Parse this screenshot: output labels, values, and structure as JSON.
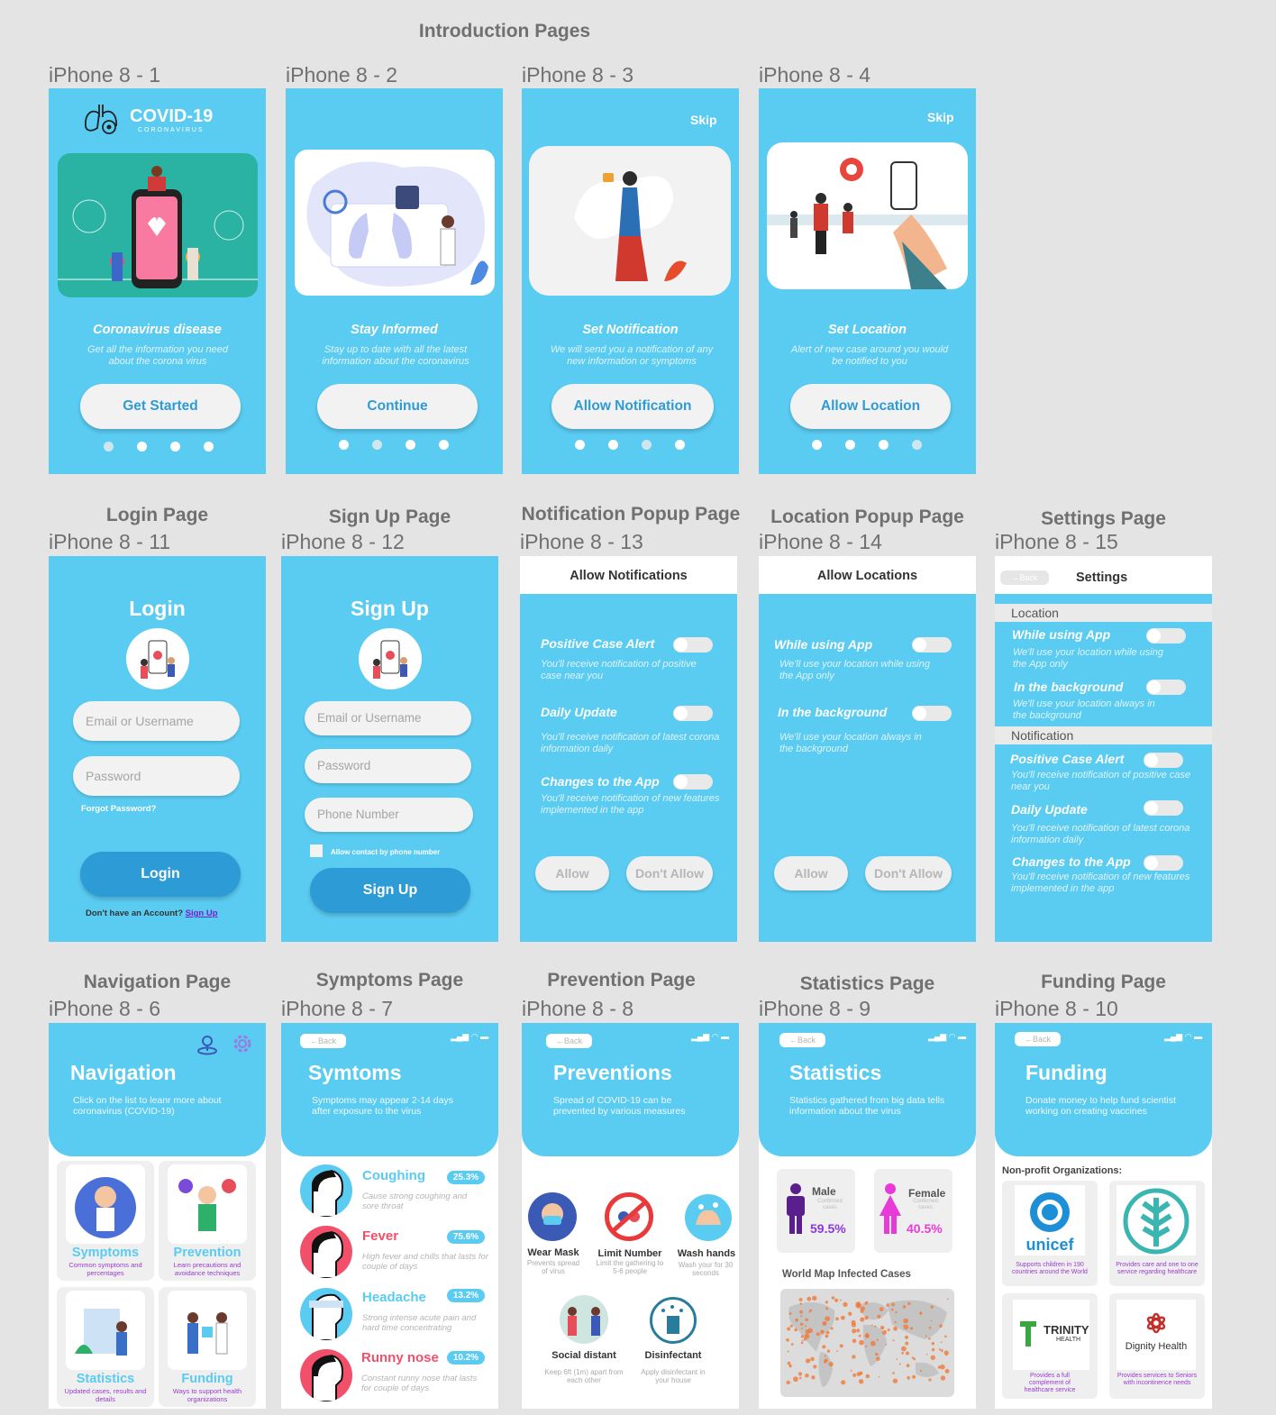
{
  "intro_title": "Introduction Pages",
  "sections": {
    "login": "Login Page",
    "signup": "Sign Up Page",
    "notif_popup": "Notification Popup Page",
    "loc_popup": "Location Popup Page",
    "settings": "Settings Page",
    "navigation": "Navigation Page",
    "symptoms": "Symptoms Page",
    "prevention": "Prevention Page",
    "statistics": "Statistics Page",
    "funding": "Funding Page"
  },
  "frames": {
    "f1": "iPhone 8 - 1",
    "f2": "iPhone 8 - 2",
    "f3": "iPhone 8 - 3",
    "f4": "iPhone 8 - 4",
    "f11": "iPhone 8 - 11",
    "f12": "iPhone 8 - 12",
    "f13": "iPhone 8 - 13",
    "f14": "iPhone 8 - 14",
    "f15": "iPhone 8 - 15",
    "f6": "iPhone 8 - 6",
    "f7": "iPhone 8 - 7",
    "f8": "iPhone 8 - 8",
    "f9": "iPhone 8 - 9",
    "f10": "iPhone 8 - 10"
  },
  "intro": [
    {
      "heading": "Coronavirus disease",
      "desc": "Get all the information you need about the corona virus",
      "button": "Get Started"
    },
    {
      "heading": "Stay Informed",
      "desc": "Stay up to date with all the latest information about the coronavirus",
      "button": "Continue"
    },
    {
      "heading": "Set Notification",
      "desc": "We will send you a notification of any new information or symptoms",
      "button": "Allow Notification",
      "skip": "Skip"
    },
    {
      "heading": "Set Location",
      "desc": "Alert of new case around you  would be notified to you",
      "button": "Allow Location",
      "skip": "Skip"
    }
  ],
  "logo": {
    "title": "COVID-19",
    "subtitle": "CORONAVIRUS"
  },
  "login": {
    "title": "Login",
    "email": "Email or Username",
    "password": "Password",
    "forgot": "Forgot Password?",
    "button": "Login",
    "no_account": "Don't have an Account?",
    "signup_link": "Sign Up"
  },
  "signup": {
    "title": "Sign Up",
    "email": "Email or Username",
    "password": "Password",
    "phone": "Phone Number",
    "allow_contact": "Allow contact by phone number",
    "button": "Sign Up"
  },
  "notif_popup": {
    "title": "Allow Notifications",
    "items": [
      {
        "name": "Positive Case Alert",
        "desc": "You'll receive notification of positive case near you"
      },
      {
        "name": "Daily Update",
        "desc": "You'll receive notification of latest corona information daily"
      },
      {
        "name": "Changes to the App",
        "desc": "You'll receive notification of new features implemented in the app"
      }
    ],
    "allow": "Allow",
    "dont": "Don't Allow"
  },
  "loc_popup": {
    "title": "Allow Locations",
    "items": [
      {
        "name": "While using App",
        "desc": "We'll use your location while using the App only"
      },
      {
        "name": "In the background",
        "desc": "We'll use your location always in the background"
      }
    ],
    "allow": "Allow",
    "dont": "Don't Allow"
  },
  "settings": {
    "back": "Back",
    "title": "Settings",
    "location_label": "Location",
    "notification_label": "Notification",
    "loc_items": [
      {
        "name": "While using App",
        "desc": "We'll use your location while using the App only"
      },
      {
        "name": "In the background",
        "desc": "We'll use your location always in the background"
      }
    ],
    "notif_items": [
      {
        "name": "Positive Case Alert",
        "desc": "You'll receive notification of positive case near you"
      },
      {
        "name": "Daily Update",
        "desc": "You'll receive notification of latest corona information daily"
      },
      {
        "name": "Changes to the App",
        "desc": "You'll receive notification of new features implemented in the app"
      }
    ]
  },
  "navigation": {
    "title": "Navigation",
    "desc": "Click on the list to leanr more about coronavirus (COVID-19)",
    "cards": [
      {
        "title": "Symptoms",
        "desc": "Common symptoms and percentages"
      },
      {
        "title": "Prevention",
        "desc": "Learn precautions and avoidance techniques"
      },
      {
        "title": "Statistics",
        "desc": "Updated cases, results and details"
      },
      {
        "title": "Funding",
        "desc": "Ways to support health organizations"
      }
    ]
  },
  "symptoms": {
    "back": "Back",
    "title": "Symtoms",
    "desc": "Symptoms may appear 2-14 days after exposure to the virus",
    "items": [
      {
        "name": "Coughing",
        "pct": "25.3%",
        "desc": "Cause strong coughing and sore throat"
      },
      {
        "name": "Fever",
        "pct": "75.6%",
        "desc": "High fever and chills that lasts for couple of days"
      },
      {
        "name": "Headache",
        "pct": "13.2%",
        "desc": "Strong intense acute pain and hard time concentrating"
      },
      {
        "name": "Runny nose",
        "pct": "10.2%",
        "desc": "Constant runny nose that lasts for couple of days"
      }
    ]
  },
  "prevention": {
    "back": "Back",
    "title": "Preventions",
    "desc": "Spread of COVID-19 can be prevented by various measures",
    "items": [
      {
        "name": "Wear Mask",
        "desc": "Prevents spread of virus"
      },
      {
        "name": "Limit Number",
        "desc": "Limit the gathering to 5-6 people"
      },
      {
        "name": "Wash hands",
        "desc": "Wash your for 30 seconds"
      },
      {
        "name": "Social distant",
        "desc": "Keep 6ft (1m) apart from each other"
      },
      {
        "name": "Disinfectant",
        "desc": "Apply disinfectant in your house"
      }
    ]
  },
  "statistics": {
    "back": "Back",
    "title": "Statistics",
    "desc": "Statistics gathered from big data tells information about the virus",
    "male": {
      "label": "Male",
      "sub": "Confirmed cases",
      "pct": "59.5%"
    },
    "female": {
      "label": "Female",
      "sub": "Confirmed cases",
      "pct": "40.5%"
    },
    "map_title": "World Map Infected Cases"
  },
  "funding": {
    "back": "Back",
    "title": "Funding",
    "desc": "Donate money to help fund scientist working on creating vaccines",
    "org_label": "Non-profit Organizations:",
    "orgs": [
      {
        "name": "unicef",
        "desc": "Supports children in 190 countries around the World"
      },
      {
        "name": "",
        "desc": "Provides care and one to one service regarding healthcare"
      },
      {
        "name": "TRINITY",
        "sub": "HEALTH",
        "desc": "Provides a full complement of healthcare service"
      },
      {
        "name": "Dignity Health",
        "desc": "Provides services to Seniors with incontinence needs"
      }
    ]
  },
  "colors": {
    "primary": "#5acbf1",
    "button_blue": "#2d9bd6",
    "purple": "#9a3ccf",
    "male": "#5a1f8c",
    "female": "#e83ad8"
  }
}
